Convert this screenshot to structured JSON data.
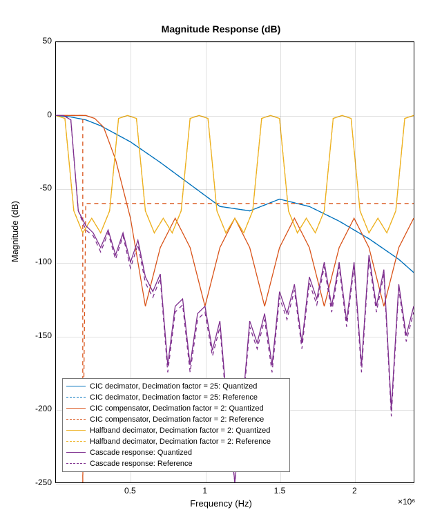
{
  "chart_data": {
    "type": "line",
    "title": "Magnitude Response (dB)",
    "xlabel": "Frequency (Hz)",
    "ylabel": "Magnitude (dB)",
    "x_exponent_label": "×10⁶",
    "xlim": [
      0,
      2400000
    ],
    "ylim": [
      -250,
      50
    ],
    "xticks": [
      500000,
      1000000,
      1500000,
      2000000
    ],
    "xtick_labels": [
      "0.5",
      "1",
      "1.5",
      "2"
    ],
    "yticks": [
      -250,
      -200,
      -150,
      -100,
      -50,
      0,
      50
    ],
    "ytick_labels": [
      "-250",
      "-200",
      "-150",
      "-100",
      "-50",
      "0",
      "50"
    ],
    "grid": true,
    "legend_position": "lower-left",
    "series": [
      {
        "name": "CIC decimator, Decimation factor = 25: Quantized",
        "color": "#0072BD",
        "dash": "solid",
        "x": [
          0,
          100000,
          200000,
          300000,
          500000,
          700000,
          900000,
          1100000,
          1300000,
          1500000,
          1700000,
          1900000,
          2100000,
          2300000,
          2400000
        ],
        "y": [
          0,
          -1,
          -3,
          -7,
          -18,
          -32,
          -47,
          -62,
          -65,
          -57,
          -62,
          -72,
          -84,
          -98,
          -107
        ]
      },
      {
        "name": "CIC decimator, Decimation factor = 25: Reference",
        "color": "#0072BD",
        "dash": "dashed",
        "x": [
          0,
          100000,
          200000,
          300000,
          500000,
          700000,
          900000,
          1100000,
          1300000,
          1500000,
          1700000,
          1900000,
          2100000,
          2300000,
          2400000
        ],
        "y": [
          0,
          -1,
          -3,
          -7,
          -18,
          -32,
          -47,
          -62,
          -65,
          -57,
          -62,
          -72,
          -84,
          -98,
          -107
        ]
      },
      {
        "name": "CIC compensator, Decimation factor = 2: Quantized",
        "color": "#D95319",
        "dash": "solid",
        "x": [
          0,
          80000,
          160000,
          200000,
          260000,
          320000,
          400000,
          500000,
          600000,
          700000,
          800000,
          900000,
          1000000,
          1100000,
          1200000,
          1300000,
          1400000,
          1500000,
          1600000,
          1700000,
          1800000,
          1900000,
          2000000,
          2100000,
          2200000,
          2300000,
          2400000
        ],
        "y": [
          0,
          0,
          0,
          0,
          -2,
          -8,
          -30,
          -70,
          -130,
          -90,
          -70,
          -90,
          -130,
          -90,
          -70,
          -90,
          -130,
          -90,
          -70,
          -90,
          -130,
          -90,
          -70,
          -90,
          -130,
          -90,
          -70
        ]
      },
      {
        "name": "CIC compensator, Decimation factor = 2: Reference",
        "color": "#D95319",
        "dash": "dashed",
        "x": [
          0,
          180000,
          180001,
          200000,
          200001,
          2400000
        ],
        "y": [
          0,
          0,
          -250,
          -60,
          -60,
          -60
        ]
      },
      {
        "name": "Halfband decimator, Decimation factor = 2: Quantized",
        "color": "#EDB120",
        "dash": "solid",
        "x": [
          0,
          60000,
          120000,
          180000,
          240000,
          300000,
          360000,
          420000,
          480000,
          540000,
          600000,
          660000,
          720000,
          780000,
          840000,
          900000,
          960000,
          1020000,
          1080000,
          1140000,
          1200000,
          1260000,
          1320000,
          1380000,
          1440000,
          1500000,
          1560000,
          1620000,
          1680000,
          1740000,
          1800000,
          1860000,
          1920000,
          1980000,
          2040000,
          2100000,
          2160000,
          2220000,
          2280000,
          2340000,
          2400000
        ],
        "y": [
          0,
          -2,
          -65,
          -80,
          -70,
          -80,
          -65,
          -2,
          0,
          -2,
          -65,
          -80,
          -70,
          -80,
          -65,
          -2,
          0,
          -2,
          -65,
          -80,
          -70,
          -80,
          -65,
          -2,
          0,
          -2,
          -65,
          -80,
          -70,
          -80,
          -65,
          -2,
          0,
          -2,
          -65,
          -80,
          -70,
          -80,
          -65,
          -2,
          0
        ]
      },
      {
        "name": "Halfband decimator, Decimation factor = 2: Reference",
        "color": "#EDB120",
        "dash": "dashed",
        "x": [
          0,
          60000,
          120000,
          180000,
          240000,
          300000,
          360000,
          420000,
          480000,
          540000,
          600000,
          660000,
          720000,
          780000,
          840000,
          900000,
          960000,
          1020000,
          1080000,
          1140000,
          1200000,
          1260000,
          1320000,
          1380000,
          1440000,
          1500000,
          1560000,
          1620000,
          1680000,
          1740000,
          1800000,
          1860000,
          1920000,
          1980000,
          2040000,
          2100000,
          2160000,
          2220000,
          2280000,
          2340000,
          2400000
        ],
        "y": [
          0,
          -2,
          -65,
          -80,
          -70,
          -80,
          -65,
          -2,
          0,
          -2,
          -65,
          -80,
          -70,
          -80,
          -65,
          -2,
          0,
          -2,
          -65,
          -80,
          -70,
          -80,
          -65,
          -2,
          0,
          -2,
          -65,
          -80,
          -70,
          -80,
          -65,
          -2,
          0,
          -2,
          -65,
          -80,
          -70,
          -80,
          -65,
          -2,
          0
        ]
      },
      {
        "name": "Cascade response: Quantized",
        "color": "#7E2F8E",
        "dash": "solid",
        "x": [
          0,
          50000,
          100000,
          150000,
          200000,
          250000,
          300000,
          350000,
          400000,
          450000,
          500000,
          550000,
          600000,
          650000,
          700000,
          750000,
          800000,
          850000,
          900000,
          950000,
          1000000,
          1050000,
          1100000,
          1150000,
          1200000,
          1250000,
          1300000,
          1350000,
          1400000,
          1450000,
          1500000,
          1550000,
          1600000,
          1650000,
          1700000,
          1750000,
          1800000,
          1850000,
          1900000,
          1950000,
          2000000,
          2050000,
          2100000,
          2150000,
          2200000,
          2250000,
          2300000,
          2350000,
          2400000
        ],
        "y": [
          0,
          0,
          -3,
          -65,
          -75,
          -80,
          -90,
          -78,
          -95,
          -80,
          -100,
          -85,
          -110,
          -120,
          -108,
          -170,
          -130,
          -125,
          -170,
          -135,
          -130,
          -160,
          -140,
          -200,
          -250,
          -200,
          -140,
          -155,
          -135,
          -170,
          -120,
          -135,
          -115,
          -155,
          -110,
          -125,
          -100,
          -130,
          -100,
          -140,
          -100,
          -170,
          -95,
          -130,
          -105,
          -200,
          -115,
          -150,
          -130
        ]
      },
      {
        "name": "Cascade response: Reference",
        "color": "#7E2F8E",
        "dash": "dashed",
        "x": [
          0,
          50000,
          100000,
          150000,
          200000,
          250000,
          300000,
          350000,
          400000,
          450000,
          500000,
          550000,
          600000,
          650000,
          700000,
          750000,
          800000,
          850000,
          900000,
          950000,
          1000000,
          1050000,
          1100000,
          1150000,
          1200000,
          1250000,
          1300000,
          1350000,
          1400000,
          1450000,
          1500000,
          1550000,
          1600000,
          1650000,
          1700000,
          1750000,
          1800000,
          1850000,
          1900000,
          1950000,
          2000000,
          2050000,
          2100000,
          2150000,
          2200000,
          2250000,
          2300000,
          2350000,
          2400000
        ],
        "y": [
          0,
          0,
          -3,
          -65,
          -78,
          -82,
          -93,
          -80,
          -98,
          -82,
          -104,
          -88,
          -114,
          -124,
          -111,
          -175,
          -134,
          -129,
          -175,
          -139,
          -134,
          -164,
          -144,
          -205,
          -250,
          -205,
          -144,
          -159,
          -139,
          -175,
          -124,
          -139,
          -119,
          -159,
          -114,
          -129,
          -103,
          -134,
          -103,
          -144,
          -103,
          -175,
          -98,
          -134,
          -108,
          -205,
          -118,
          -154,
          -134
        ]
      }
    ]
  },
  "legend_labels": [
    "CIC decimator, Decimation factor = 25: Quantized",
    "CIC decimator, Decimation factor = 25: Reference",
    "CIC compensator, Decimation factor = 2: Quantized",
    "CIC compensator, Decimation factor = 2: Reference",
    "Halfband decimator, Decimation factor = 2: Quantized",
    "Halfband decimator, Decimation factor = 2: Reference",
    "Cascade response: Quantized",
    "Cascade response: Reference"
  ]
}
